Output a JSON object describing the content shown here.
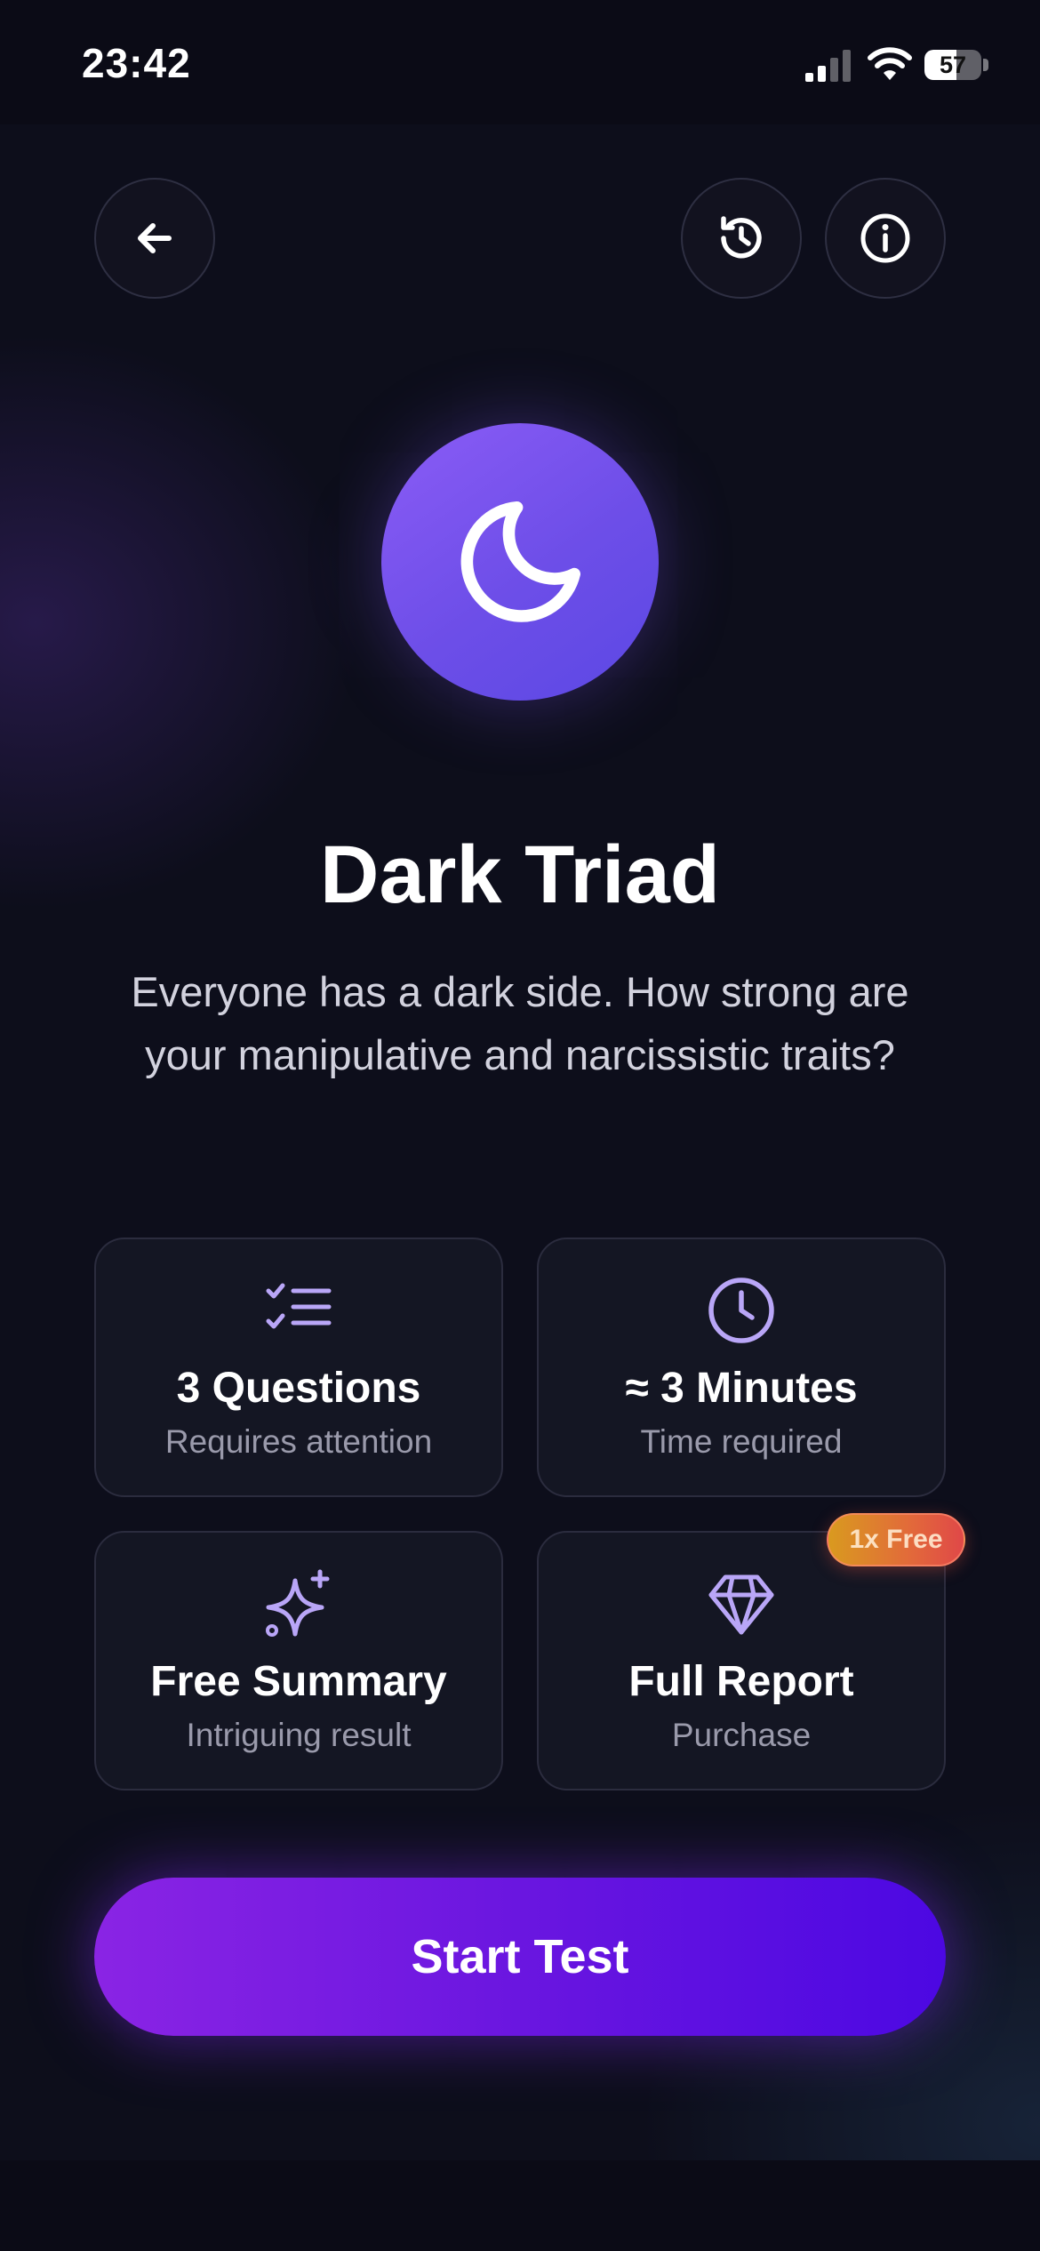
{
  "status_bar": {
    "time": "23:42",
    "battery": "57",
    "battery_level": 0.57
  },
  "header": {
    "back_icon": "arrow-left-icon",
    "history_icon": "history-clock-icon",
    "info_icon": "info-circle-icon"
  },
  "hero": {
    "icon": "moon-icon",
    "title": "Dark Triad",
    "subtitle": "Everyone has a dark side. How strong are your manipulative and narcissistic traits?"
  },
  "cards": [
    {
      "icon": "checklist-icon",
      "title": "3 Questions",
      "subtitle": "Requires attention"
    },
    {
      "icon": "clock-icon",
      "title": "≈ 3 Minutes",
      "subtitle": "Time required"
    },
    {
      "icon": "sparkle-icon",
      "title": "Free Summary",
      "subtitle": "Intriguing result"
    },
    {
      "icon": "diamond-icon",
      "title": "Full Report",
      "subtitle": "Purchase",
      "badge": "1x Free"
    }
  ],
  "cta": {
    "label": "Start Test"
  },
  "colors": {
    "accent": "#8b5cf6",
    "icon_tint": "#b9a6f7",
    "cta_start": "#8a24e4",
    "cta_end": "#4c08e2",
    "badge_start": "#d99a1f",
    "badge_end": "#e04848"
  }
}
